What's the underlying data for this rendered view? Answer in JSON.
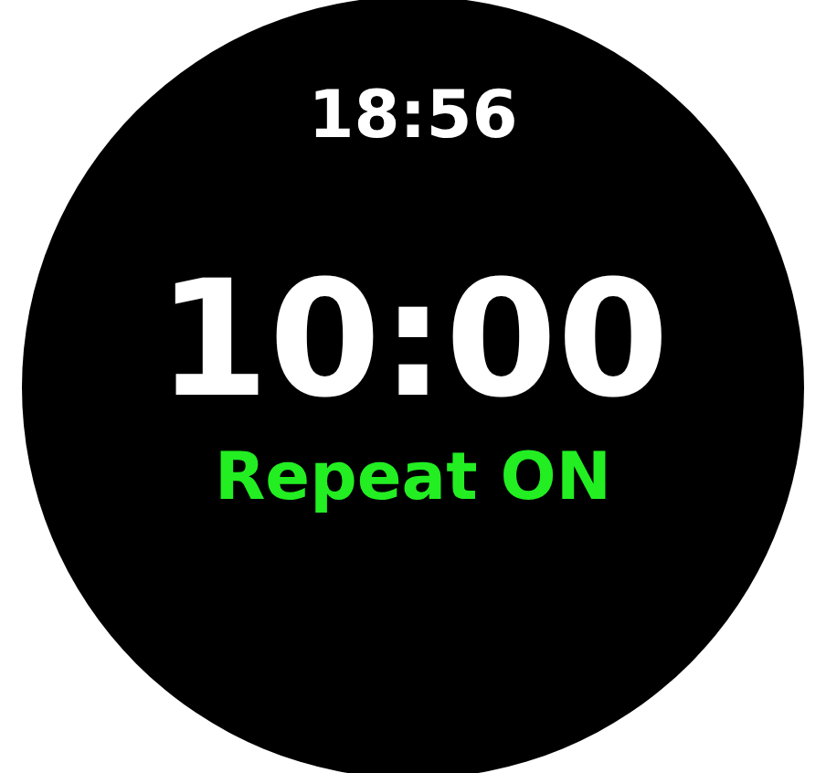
{
  "clock": {
    "time": "18:56"
  },
  "timer": {
    "value": "10:00"
  },
  "repeat": {
    "label": "Repeat ON",
    "on": true
  }
}
